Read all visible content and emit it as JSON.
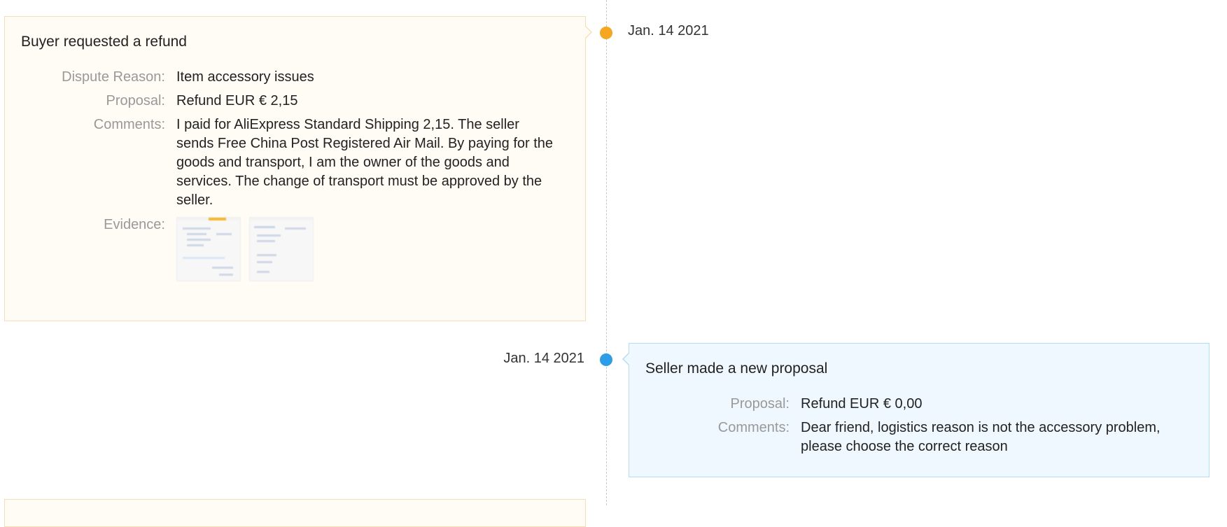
{
  "events": [
    {
      "date": "Jan. 14 2021",
      "title": "Buyer requested a refund",
      "dispute_reason_label": "Dispute Reason:",
      "dispute_reason": "Item accessory issues",
      "proposal_label": "Proposal:",
      "proposal": "Refund EUR € 2,15",
      "comments_label": "Comments:",
      "comments": "I paid for AliExpress Standard Shipping 2,15. The seller sends Free China Post Registered Air Mail. By paying for the goods and transport, I am the owner of the goods and services. The change of transport must be approved by the seller.",
      "evidence_label": "Evidence:",
      "evidence_count": 2,
      "color": "#f5a623"
    },
    {
      "date": "Jan. 14 2021",
      "title": "Seller made a new proposal",
      "proposal_label": "Proposal:",
      "proposal": "Refund EUR € 0,00",
      "comments_label": "Comments:",
      "comments": "Dear friend, logistics reason is not the accessory problem, please choose the correct reason",
      "color": "#2d9de8"
    }
  ]
}
